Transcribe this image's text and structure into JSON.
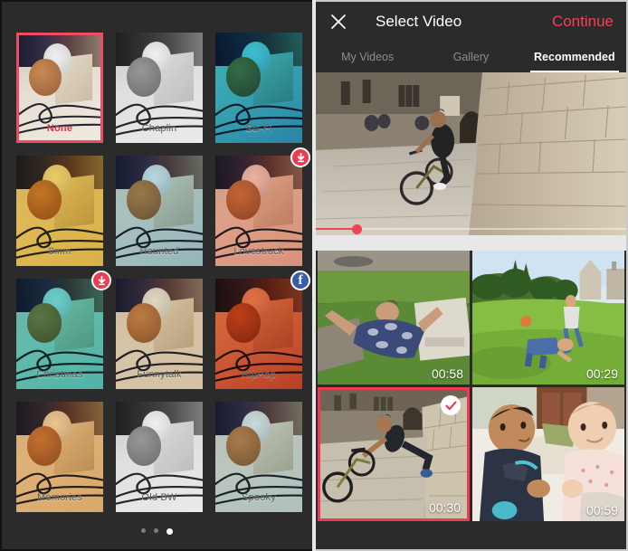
{
  "left_panel": {
    "name": "filter-picker",
    "filters": [
      {
        "label": "None",
        "selected": true,
        "badge": "none",
        "tint": "none"
      },
      {
        "label": "Chaplin",
        "selected": false,
        "badge": "none",
        "tint": "bw"
      },
      {
        "label": "Sci-Fi",
        "selected": false,
        "badge": "none",
        "tint": "scifi"
      },
      {
        "label": "8mm",
        "selected": false,
        "badge": "none",
        "tint": "8mm"
      },
      {
        "label": "Haunted",
        "selected": false,
        "badge": "none",
        "tint": "haunted"
      },
      {
        "label": "Lovestruck",
        "selected": false,
        "badge": "download",
        "tint": "lovestruck"
      },
      {
        "label": "Christmas",
        "selected": false,
        "badge": "download",
        "tint": "christmas"
      },
      {
        "label": "Funnytalk",
        "selected": false,
        "badge": "none",
        "tint": "funnytalk"
      },
      {
        "label": "HipHop",
        "selected": false,
        "badge": "facebook",
        "tint": "hiphop"
      },
      {
        "label": "Memories",
        "selected": false,
        "badge": "none",
        "tint": "memories"
      },
      {
        "label": "Old BW",
        "selected": false,
        "badge": "none",
        "tint": "oldbw"
      },
      {
        "label": "Spooky",
        "selected": false,
        "badge": "none",
        "tint": "spooky"
      }
    ],
    "facebook_badge_glyph": "f",
    "pager": {
      "total": 3,
      "active_index": 2
    },
    "colors": {
      "selection": "#ef4b62",
      "selected_text": "#d7374f",
      "panel_bg": "#2b2b2b",
      "download_badge": "#ee3b52",
      "facebook_badge": "#3b5ca8"
    }
  },
  "right_panel": {
    "name": "select-video-screen",
    "header": {
      "close_icon": "close-x-icon",
      "title": "Select Video",
      "continue_label": "Continue",
      "continue_color": "#ef4256"
    },
    "tabs": [
      {
        "label": "My Videos",
        "active": false
      },
      {
        "label": "Gallery",
        "active": false
      },
      {
        "label": "Recommended",
        "active": true
      }
    ],
    "preview": {
      "name": "video-preview",
      "scene": "bmx-rider-courtyard",
      "progress_percent": 13,
      "scrubber_color": "#ef4256"
    },
    "videos": [
      {
        "duration": "00:58",
        "scene": "boy-lying-grass",
        "selected": false
      },
      {
        "duration": "00:29",
        "scene": "kids-running-lawn",
        "selected": false
      },
      {
        "duration": "00:30",
        "scene": "bmx-cobblestone",
        "selected": true
      },
      {
        "duration": "00:59",
        "scene": "two-babies-couch",
        "selected": false
      }
    ],
    "selected_check_icon": "checkmark-icon"
  }
}
